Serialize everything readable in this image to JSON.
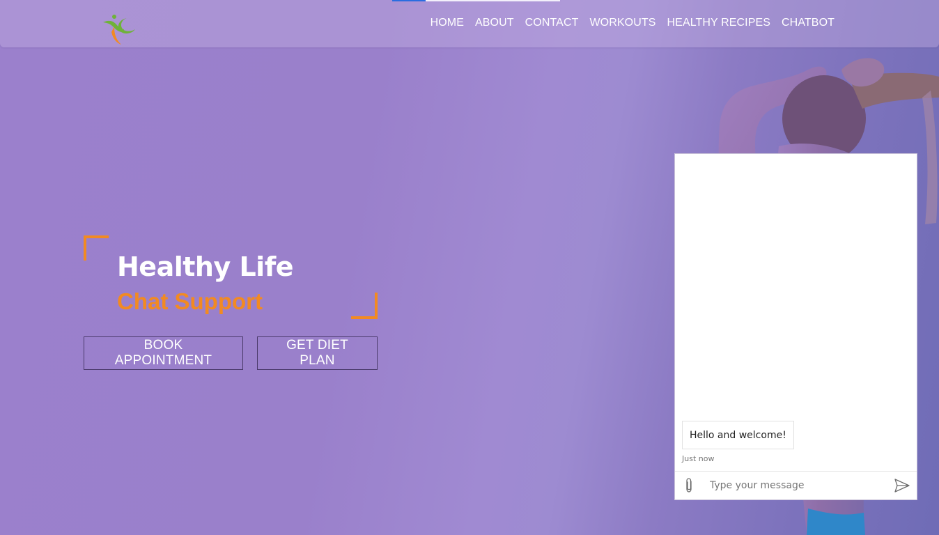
{
  "progress": {
    "fraction": 0.2,
    "color": "#2a6de0"
  },
  "header": {
    "logo_icon": "runner-logo-icon",
    "nav": [
      {
        "label": "HOME"
      },
      {
        "label": "ABOUT"
      },
      {
        "label": "CONTACT"
      },
      {
        "label": "WORKOUTS"
      },
      {
        "label": "HEALTHY RECIPES"
      },
      {
        "label": "CHATBOT"
      }
    ]
  },
  "hero": {
    "title": "Healthy Life",
    "subtitle": "Chat Support",
    "accent_color": "#f28a22",
    "buttons": {
      "book": "BOOK APPOINTMENT",
      "diet": "GET DIET PLAN"
    }
  },
  "chat": {
    "messages": [
      {
        "text": "Hello and welcome!",
        "time": "Just now"
      }
    ],
    "input_placeholder": "Type your message",
    "attach_icon": "paperclip-icon",
    "send_icon": "send-icon"
  }
}
